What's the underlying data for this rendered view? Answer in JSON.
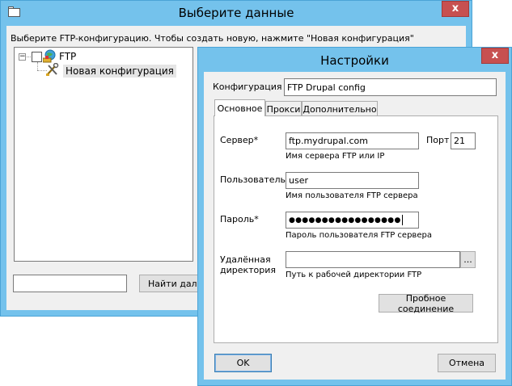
{
  "dialog1": {
    "title": "Выберите данные",
    "close_glyph": "x",
    "instruction": "Выберите FTP-конфигурацию. Чтобы создать новую, нажмите \"Новая конфигурация\"",
    "tree": {
      "expander": "−",
      "root_label": "FTP",
      "child_label": "Новая конфигурация"
    },
    "search_value": "",
    "find_next_label": "Найти далее"
  },
  "dialog2": {
    "title": "Настройки",
    "close_glyph": "x",
    "config_label": "Конфигурация",
    "config_value": "FTP Drupal config",
    "tabs": [
      {
        "label": "Основное",
        "active": true
      },
      {
        "label": "Прокси",
        "active": false
      },
      {
        "label": "Дополнительно",
        "active": false
      }
    ],
    "server": {
      "label": "Сервер*",
      "value": "ftp.mydrupal.com",
      "hint": "Имя сервера FTP или IP"
    },
    "port": {
      "label": "Порт",
      "value": "21"
    },
    "user": {
      "label": "Пользователь*",
      "value": "user",
      "hint": "Имя пользователя FTP сервера"
    },
    "password": {
      "label": "Пароль*",
      "value": "●●●●●●●●●●●●●●●●●",
      "hint": "Пароль пользователя FTP сервера"
    },
    "remote_dir": {
      "label_line1": "Удалённая",
      "label_line2": "директория",
      "value": "",
      "browse_label": "...",
      "hint": "Путь к рабочей директории FTP"
    },
    "test_button_label": "Пробное соединение",
    "ok_label": "OK",
    "cancel_label": "Отмена"
  }
}
